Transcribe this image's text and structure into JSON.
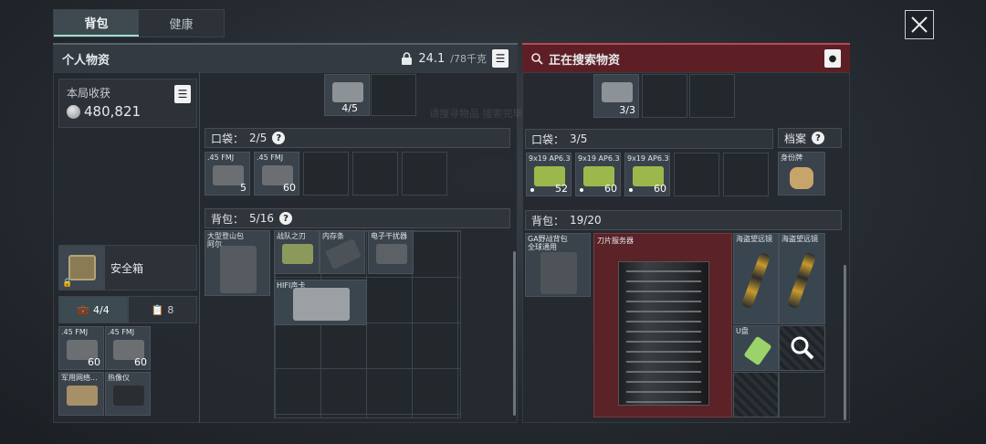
{
  "tabs": {
    "bag": "背包",
    "health": "健康"
  },
  "left_header": {
    "title": "个人物资",
    "weight": "24.1",
    "weight_max": "/78千克"
  },
  "right_header": {
    "title": "正在搜索物资"
  },
  "harvest": {
    "label": "本局收获",
    "value": "480,821"
  },
  "safe_box": {
    "label": "安全箱"
  },
  "subtabs": {
    "items_count": "4/4",
    "other_count": "8"
  },
  "safe_items": [
    {
      "name": ".45 FMJ",
      "count": "60"
    },
    {
      "name": ".45 FMJ",
      "count": "60"
    },
    {
      "name": "军用网络...",
      "count": ""
    },
    {
      "name": "热像仪",
      "count": ""
    }
  ],
  "left_top_slot": {
    "count": "4/5"
  },
  "right_top_slot": {
    "count": "3/3"
  },
  "pockets_left": {
    "label": "口袋：",
    "value": "2/5",
    "items": [
      {
        "name": ".45 FMJ",
        "count": "5"
      },
      {
        "name": ".45 FMJ",
        "count": "60"
      }
    ]
  },
  "backpack_left": {
    "label": "背包：",
    "value": "5/16",
    "items": [
      {
        "name": "大型登山包 阿尔...",
        "count": ""
      },
      {
        "name": "战队之刃",
        "count": ""
      },
      {
        "name": "内存条",
        "count": ""
      },
      {
        "name": "电子干扰器",
        "count": ""
      },
      {
        "name": "HIFI声卡",
        "count": ""
      }
    ]
  },
  "pockets_right": {
    "label": "口袋：",
    "value": "3/5",
    "items": [
      {
        "name": "9x19 AP6.3",
        "count": "52"
      },
      {
        "name": "9x19 AP6.3",
        "count": "60"
      },
      {
        "name": "9x19 AP6.3",
        "count": "60"
      }
    ]
  },
  "archive": {
    "label": "档案",
    "item": "身份牌"
  },
  "backpack_right": {
    "label": "背包：",
    "value": "19/20",
    "items": [
      {
        "name": "GA野战背包 全球通用",
        "count": ""
      },
      {
        "name": "刀片服务器",
        "count": ""
      },
      {
        "name": "海盗望远镜",
        "count": ""
      },
      {
        "name": "海盗望远镜",
        "count": ""
      },
      {
        "name": "U盘",
        "count": ""
      }
    ]
  },
  "watermark": "请搜寻物品 搜索完毕",
  "colors": {
    "accent": "#9fe0d0",
    "search_header": "#5d1f25",
    "search_item": "#5b2328"
  },
  "icons": [
    "close-icon",
    "lock-icon",
    "list-icon",
    "search-icon",
    "location-pin-icon",
    "coin-icon",
    "briefcase-icon",
    "clipboard-icon",
    "magnifier-icon",
    "question-icon"
  ]
}
